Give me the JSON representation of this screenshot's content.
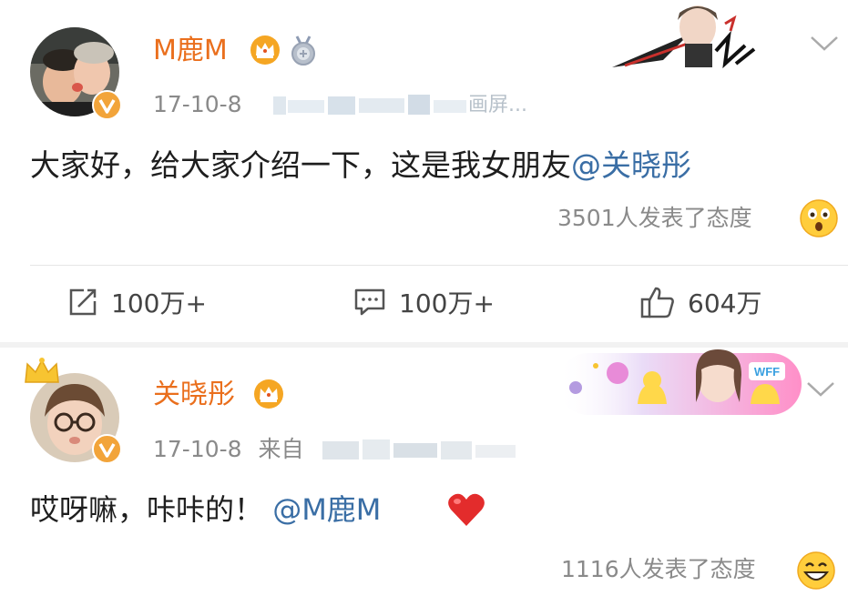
{
  "posts": [
    {
      "author": "M鹿M",
      "date": "17-10-8",
      "text_main": "大家好，给大家介绍一下，这是我女朋友",
      "mention": "@关晓彤",
      "reactions": "3501人发表了态度",
      "reaction_emoji": "surprised-face-icon",
      "source_blurred_tail": "画屏..."
    },
    {
      "author": "关晓彤",
      "date": "17-10-8",
      "source_prefix": "来自",
      "text_main": "哎呀嘛，咔咔的！",
      "mention": "@M鹿M",
      "reactions": "1116人发表了态度",
      "reaction_emoji": "grinning-face-icon",
      "deco_badge": "WFF"
    }
  ],
  "actions": {
    "share_count": "100万+",
    "comment_count": "100万+",
    "like_count": "604万"
  },
  "icons": {
    "crown": "crown-icon",
    "medal": "medal-icon",
    "verified": "verified-badge-icon",
    "share": "share-icon",
    "comment": "comment-icon",
    "like": "thumb-up-icon",
    "chevron": "chevron-down-icon",
    "heart": "heart-icon"
  },
  "colors": {
    "name_orange": "#ea6f1d",
    "mention_blue": "#3a6ea5",
    "meta_gray": "#8a8a8a"
  }
}
